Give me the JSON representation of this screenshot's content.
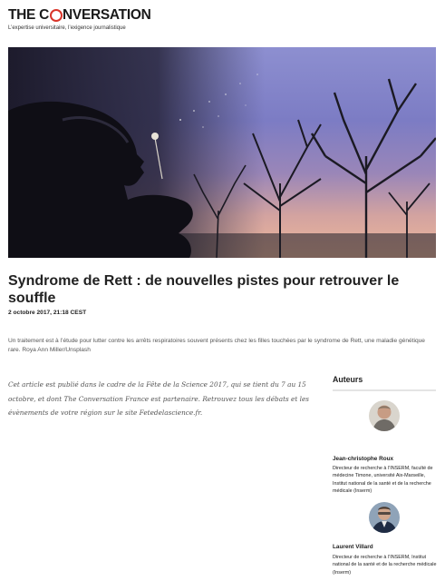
{
  "brand": {
    "logo_left": "THE C",
    "logo_right": "NVERSATION",
    "tagline": "L’expertise universitaire, l’exigence journalistique",
    "accent": "#d8352a"
  },
  "article": {
    "title": "Syndrome de Rett : de nouvelles pistes pour retrouver le souffle",
    "date": "2 octobre 2017, 21:18 CEST",
    "caption": "Un traitement est à l’étude pour lutter contre les arrêts respiratoires souvent présents chez les filles touchées par le syndrome de Rett, une maladie génétique rare. Roya Ann Miller/Unsplash",
    "intro": "Cet article est publié dans le cadre de la Fête de la Science 2017, qui se tient du 7 au 15 octobre, et dont The Conversation France est partenaire. Retrouvez tous les débats et les évènements de votre région sur le site Fetedelascience.fr."
  },
  "authors": {
    "heading": "Auteurs",
    "list": [
      {
        "name": "Jean-christophe Roux",
        "role": "Directeur de recherche à l’INSERM, faculté de médecine Timone, université Aix-Marseille, Institut national de la santé et de la recherche médicale (Inserm)"
      },
      {
        "name": "Laurent Villard",
        "role": "Directeur de recherche à l’INSERM, Institut national de la santé et de la recherche médicale (Inserm)"
      }
    ]
  }
}
